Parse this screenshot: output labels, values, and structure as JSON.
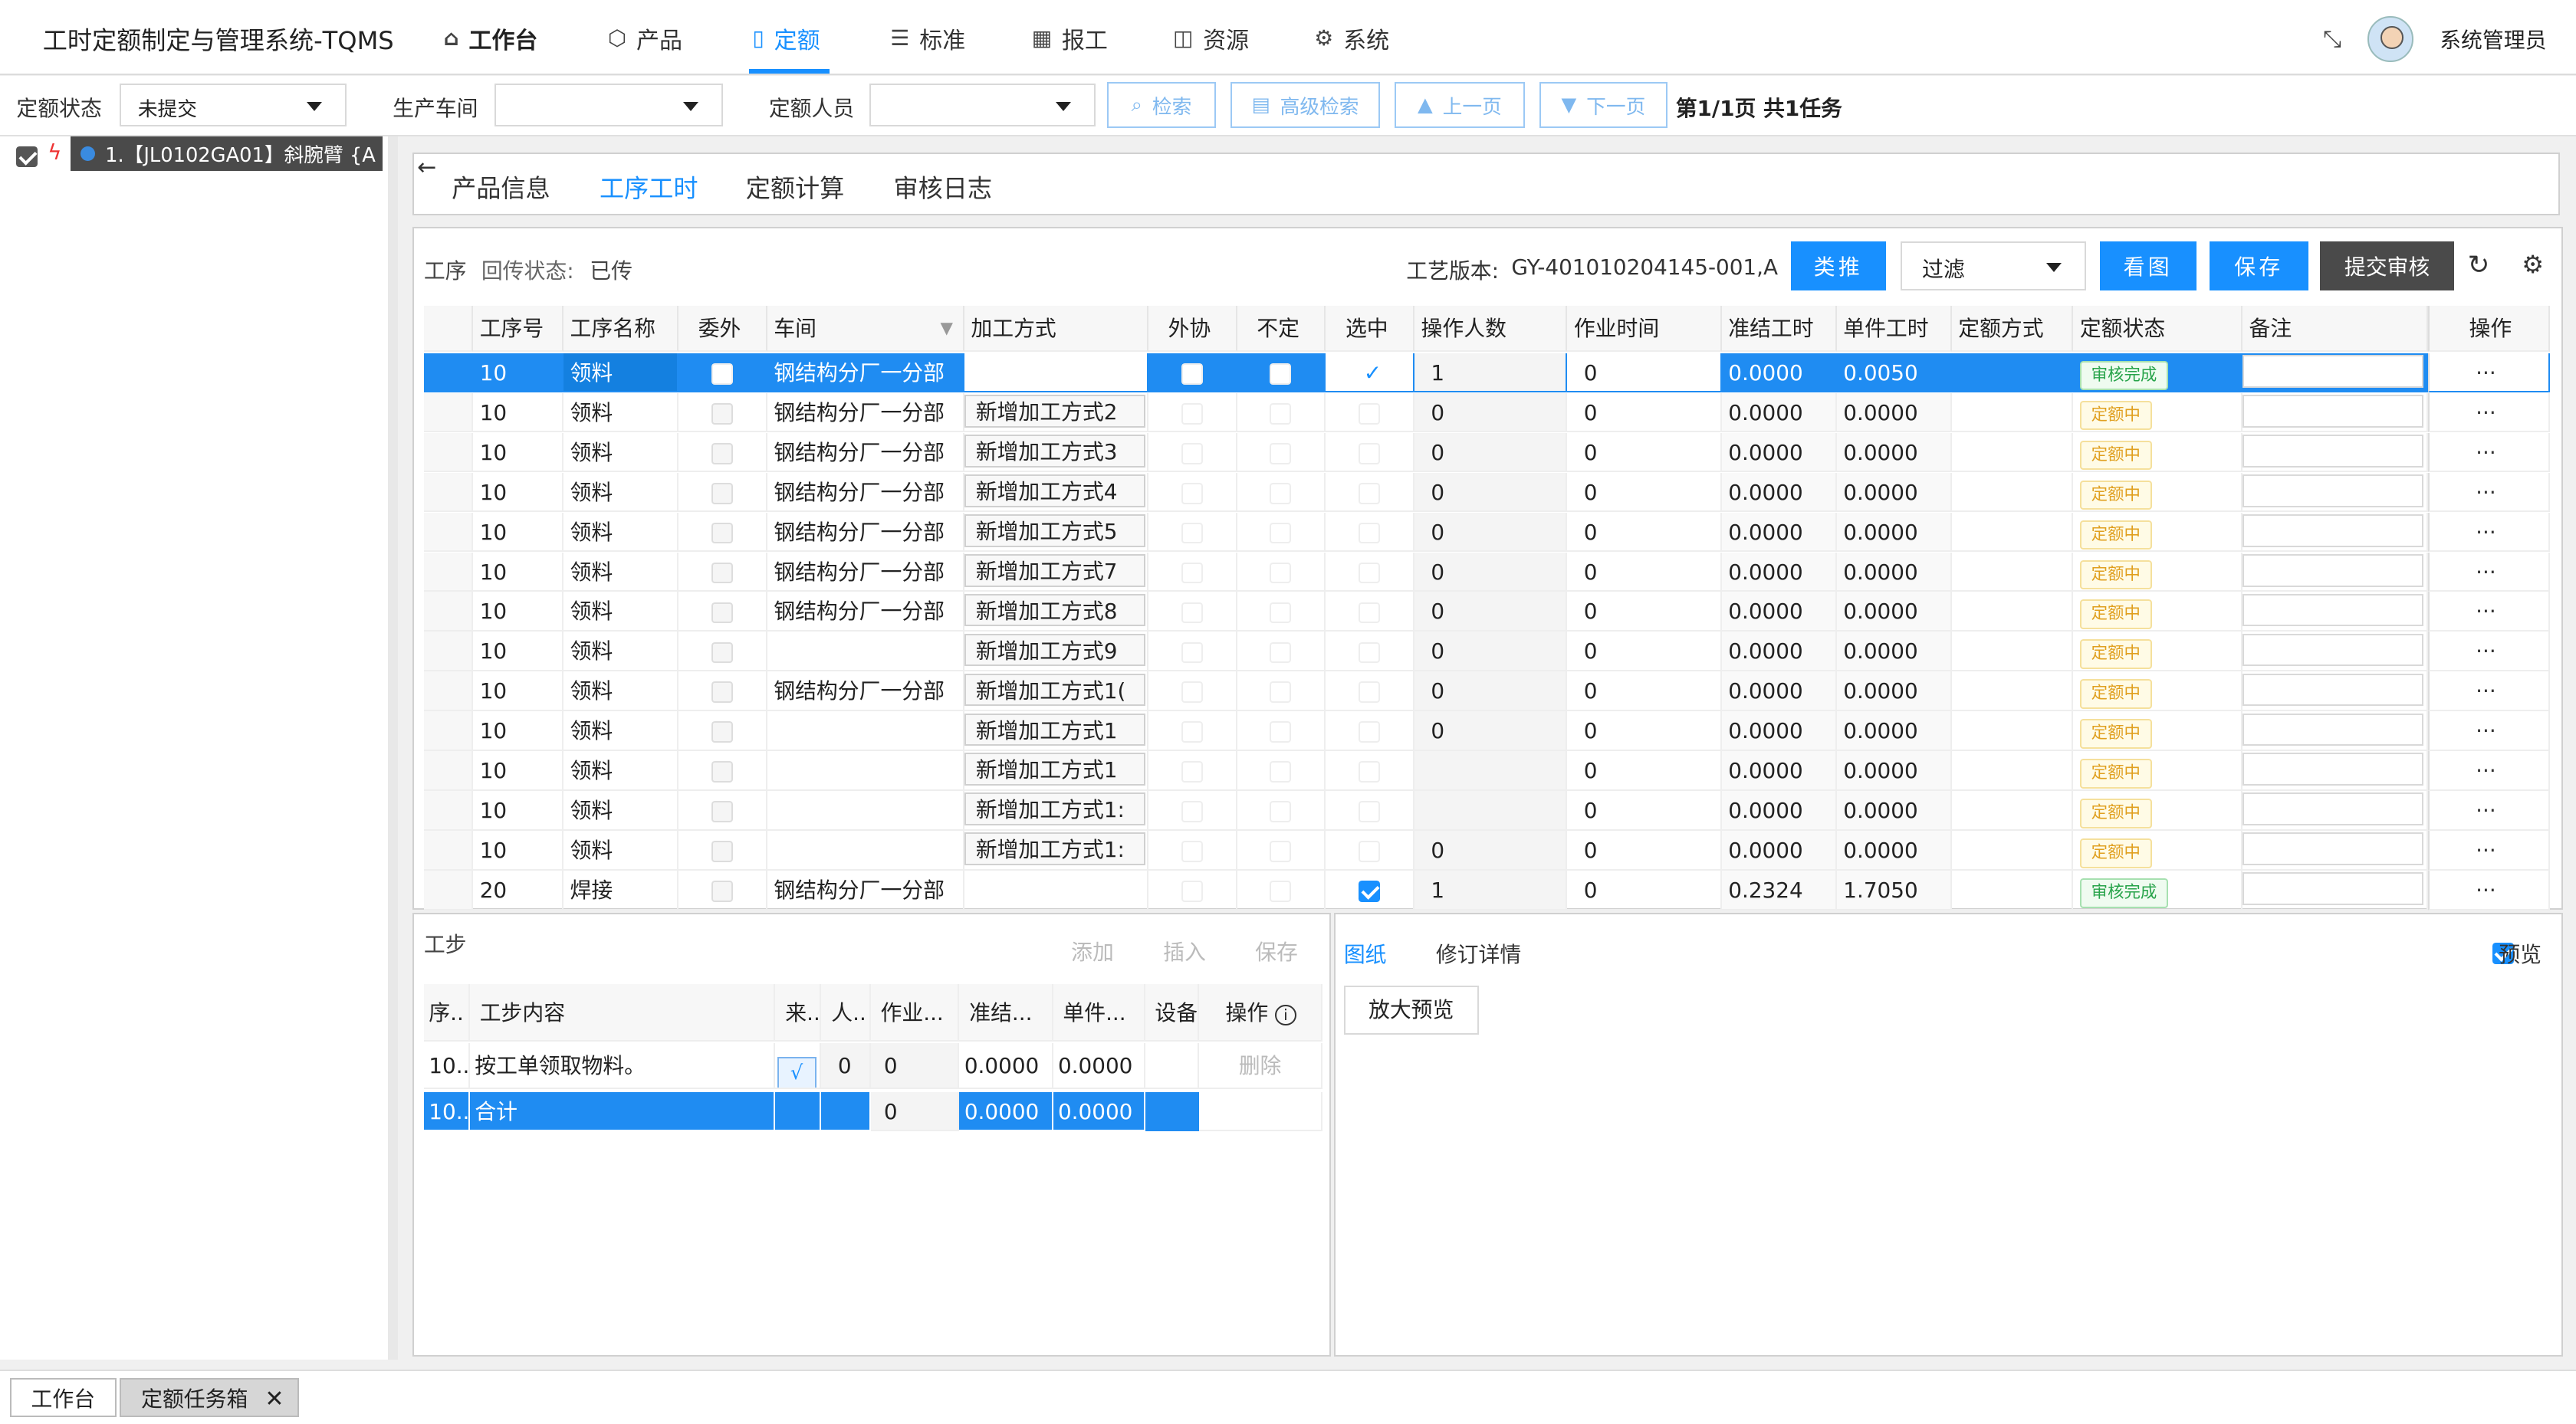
{
  "app": {
    "title": "工时定额制定与管理系统-TQMS",
    "user": "系统管理员"
  },
  "nav": [
    {
      "label": "工作台",
      "icon": "home-icon"
    },
    {
      "label": "产品",
      "icon": "cube-icon"
    },
    {
      "label": "定额",
      "icon": "doc-icon"
    },
    {
      "label": "标准",
      "icon": "list-icon"
    },
    {
      "label": "报工",
      "icon": "grid-icon"
    },
    {
      "label": "资源",
      "icon": "briefcase-icon"
    },
    {
      "label": "系统",
      "icon": "gear-icon"
    }
  ],
  "filters": {
    "quota_status_label": "定额状态",
    "quota_status_value": "未提交",
    "workshop_label": "生产车间",
    "workshop_value": "",
    "quota_person_label": "定额人员",
    "quota_person_value": "",
    "search": "检索",
    "advanced_search": "高级检索",
    "prev": "上一页",
    "next": "下一页",
    "page_info": "第1/1页 共1任务"
  },
  "tree": {
    "item": "1.【JL0102GA01】斜腕臂 {A"
  },
  "tabs": [
    "产品信息",
    "工序工时",
    "定额计算",
    "审核日志"
  ],
  "process": {
    "section_label": "工序",
    "sync_label": "回传状态:",
    "sync_value": "已传",
    "version_label": "工艺版本:",
    "version_value": "GY-401010204145-001,A",
    "btn_push": "类推",
    "filter_value": "过滤",
    "btn_view": "看图",
    "btn_save": "保存",
    "btn_submit": "提交审核"
  },
  "grid": {
    "headers": [
      "工序号",
      "工序名称",
      "委外",
      "车间",
      "加工方式",
      "外协",
      "不定",
      "选中",
      "操作人数",
      "作业时间",
      "准结工时",
      "单件工时",
      "定额方式",
      "定额状态",
      "备注",
      "操作"
    ],
    "rows": [
      {
        "no": "10",
        "name": "领料",
        "ws": "钢结构分厂一分部",
        "method": "",
        "checked": true,
        "ppl": "1",
        "time": "0",
        "prep": "0.0000",
        "unit": "0.0050",
        "status": "审核完成",
        "op": "···"
      },
      {
        "no": "10",
        "name": "领料",
        "ws": "钢结构分厂一分部",
        "method": "新增加工方式2",
        "checked": false,
        "ppl": "0",
        "time": "0",
        "prep": "0.0000",
        "unit": "0.0000",
        "status": "定额中",
        "op": "···"
      },
      {
        "no": "10",
        "name": "领料",
        "ws": "钢结构分厂一分部",
        "method": "新增加工方式3",
        "checked": false,
        "ppl": "0",
        "time": "0",
        "prep": "0.0000",
        "unit": "0.0000",
        "status": "定额中",
        "op": "···"
      },
      {
        "no": "10",
        "name": "领料",
        "ws": "钢结构分厂一分部",
        "method": "新增加工方式4",
        "checked": false,
        "ppl": "0",
        "time": "0",
        "prep": "0.0000",
        "unit": "0.0000",
        "status": "定额中",
        "op": "···"
      },
      {
        "no": "10",
        "name": "领料",
        "ws": "钢结构分厂一分部",
        "method": "新增加工方式5",
        "checked": false,
        "ppl": "0",
        "time": "0",
        "prep": "0.0000",
        "unit": "0.0000",
        "status": "定额中",
        "op": "···"
      },
      {
        "no": "10",
        "name": "领料",
        "ws": "钢结构分厂一分部",
        "method": "新增加工方式7",
        "checked": false,
        "ppl": "0",
        "time": "0",
        "prep": "0.0000",
        "unit": "0.0000",
        "status": "定额中",
        "op": "···"
      },
      {
        "no": "10",
        "name": "领料",
        "ws": "钢结构分厂一分部",
        "method": "新增加工方式8",
        "checked": false,
        "ppl": "0",
        "time": "0",
        "prep": "0.0000",
        "unit": "0.0000",
        "status": "定额中",
        "op": "···"
      },
      {
        "no": "10",
        "name": "领料",
        "ws": "",
        "method": "新增加工方式9",
        "checked": false,
        "ppl": "0",
        "time": "0",
        "prep": "0.0000",
        "unit": "0.0000",
        "status": "定额中",
        "op": "···"
      },
      {
        "no": "10",
        "name": "领料",
        "ws": "钢结构分厂一分部",
        "method": "新增加工方式1(",
        "checked": false,
        "ppl": "0",
        "time": "0",
        "prep": "0.0000",
        "unit": "0.0000",
        "status": "定额中",
        "op": "···"
      },
      {
        "no": "10",
        "name": "领料",
        "ws": "",
        "method": "新增加工方式1",
        "checked": false,
        "ppl": "0",
        "time": "0",
        "prep": "0.0000",
        "unit": "0.0000",
        "status": "定额中",
        "op": "···"
      },
      {
        "no": "10",
        "name": "领料",
        "ws": "",
        "method": "新增加工方式1",
        "checked": false,
        "ppl": "",
        "time": "0",
        "prep": "0.0000",
        "unit": "0.0000",
        "status": "定额中",
        "op": "···"
      },
      {
        "no": "10",
        "name": "领料",
        "ws": "",
        "method": "新增加工方式1:",
        "checked": false,
        "ppl": "",
        "time": "0",
        "prep": "0.0000",
        "unit": "0.0000",
        "status": "定额中",
        "op": "···"
      },
      {
        "no": "10",
        "name": "领料",
        "ws": "",
        "method": "新增加工方式1:",
        "checked": false,
        "ppl": "0",
        "time": "0",
        "prep": "0.0000",
        "unit": "0.0000",
        "status": "定额中",
        "op": "···"
      },
      {
        "no": "20",
        "name": "焊接",
        "ws": "钢结构分厂一分部",
        "method": "",
        "checked": true,
        "ppl": "1",
        "time": "0",
        "prep": "0.2324",
        "unit": "1.7050",
        "status": "审核完成",
        "op": "···"
      }
    ]
  },
  "steps": {
    "title": "工步",
    "add": "添加",
    "insert": "插入",
    "save": "保存",
    "headers": [
      "序..",
      "工步内容",
      "来..",
      "人..",
      "作业...",
      "准结...",
      "单件...",
      "设备",
      "操作"
    ],
    "row": {
      "seq": "10...",
      "content": "按工单领取物料。",
      "src": "√",
      "ppl": "0",
      "time": "0",
      "prep": "0.0000",
      "unit": "0.0000",
      "op": "删除"
    },
    "total": {
      "seq": "10...",
      "content": "合计",
      "time": "0",
      "prep": "0.0000",
      "unit": "0.0000"
    }
  },
  "right_panel": {
    "tab_drawing": "图纸",
    "tab_revision": "修订详情",
    "preview": "预览",
    "zoom_preview": "放大预览"
  },
  "bottom_tabs": [
    "工作台",
    "定额任务箱"
  ]
}
